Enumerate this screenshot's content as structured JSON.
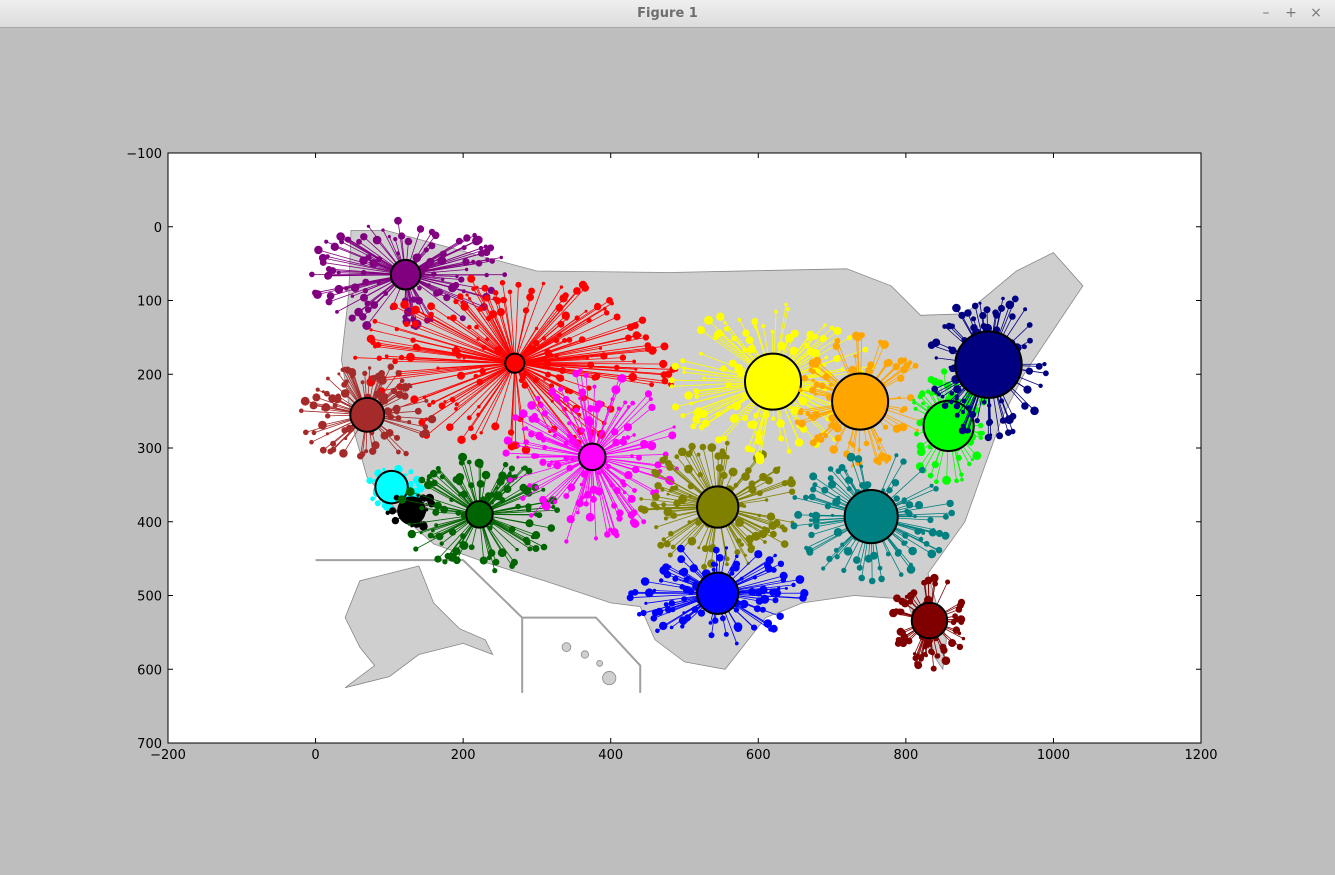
{
  "window": {
    "title": "Figure 1",
    "buttons": {
      "minimize": "–",
      "maximize": "+",
      "close": "×"
    }
  },
  "chart_data": {
    "type": "scatter",
    "title": "",
    "xlabel": "",
    "ylabel": "",
    "xlim": [
      -200,
      1200
    ],
    "ylim": [
      700,
      -100
    ],
    "y_inverted": true,
    "grid": false,
    "xticks": [
      -200,
      0,
      200,
      400,
      600,
      800,
      1000,
      1200
    ],
    "yticks": [
      -100,
      0,
      100,
      200,
      300,
      400,
      500,
      600,
      700
    ],
    "xtick_labels": [
      "−200",
      "0",
      "200",
      "400",
      "600",
      "800",
      "1000",
      "1200"
    ],
    "ytick_labels": [
      "−100",
      "0",
      "100",
      "200",
      "300",
      "400",
      "500",
      "600",
      "700"
    ],
    "background_map": "United States counties (gray) with Alaska and Hawaii insets",
    "map_fill": "#cfcfcf",
    "clusters": [
      {
        "color": "#800080",
        "center": [
          122,
          65
        ],
        "radius_units": 20,
        "spread": [
          140,
          75
        ]
      },
      {
        "color": "#ff0000",
        "center": [
          270,
          185
        ],
        "radius_units": 13,
        "spread": [
          220,
          120
        ]
      },
      {
        "color": "#a52a2a",
        "center": [
          70,
          255
        ],
        "radius_units": 23,
        "spread": [
          90,
          70
        ]
      },
      {
        "color": "#00ffff",
        "center": [
          103,
          353
        ],
        "radius_units": 22,
        "spread": [
          40,
          30
        ]
      },
      {
        "color": "#000000",
        "center": [
          130,
          385
        ],
        "radius_units": 18,
        "spread": [
          35,
          25
        ]
      },
      {
        "color": "#006400",
        "center": [
          222,
          390
        ],
        "radius_units": 18,
        "spread": [
          110,
          80
        ]
      },
      {
        "color": "#ff00ff",
        "center": [
          375,
          312
        ],
        "radius_units": 18,
        "spread": [
          120,
          120
        ]
      },
      {
        "color": "#808000",
        "center": [
          545,
          380
        ],
        "radius_units": 28,
        "spread": [
          110,
          90
        ]
      },
      {
        "color": "#ffff00",
        "center": [
          620,
          210
        ],
        "radius_units": 38,
        "spread": [
          140,
          110
        ]
      },
      {
        "color": "#ffa500",
        "center": [
          738,
          237
        ],
        "radius_units": 38,
        "spread": [
          90,
          90
        ]
      },
      {
        "color": "#00ff00",
        "center": [
          858,
          270
        ],
        "radius_units": 34,
        "spread": [
          55,
          80
        ]
      },
      {
        "color": "#000080",
        "center": [
          912,
          187
        ],
        "radius_units": 45,
        "spread": [
          80,
          100
        ]
      },
      {
        "color": "#008080",
        "center": [
          753,
          393
        ],
        "radius_units": 36,
        "spread": [
          110,
          90
        ]
      },
      {
        "color": "#0000ff",
        "center": [
          545,
          497
        ],
        "radius_units": 28,
        "spread": [
          120,
          70
        ]
      },
      {
        "color": "#800000",
        "center": [
          832,
          534
        ],
        "radius_units": 24,
        "spread": [
          50,
          70
        ]
      }
    ]
  }
}
